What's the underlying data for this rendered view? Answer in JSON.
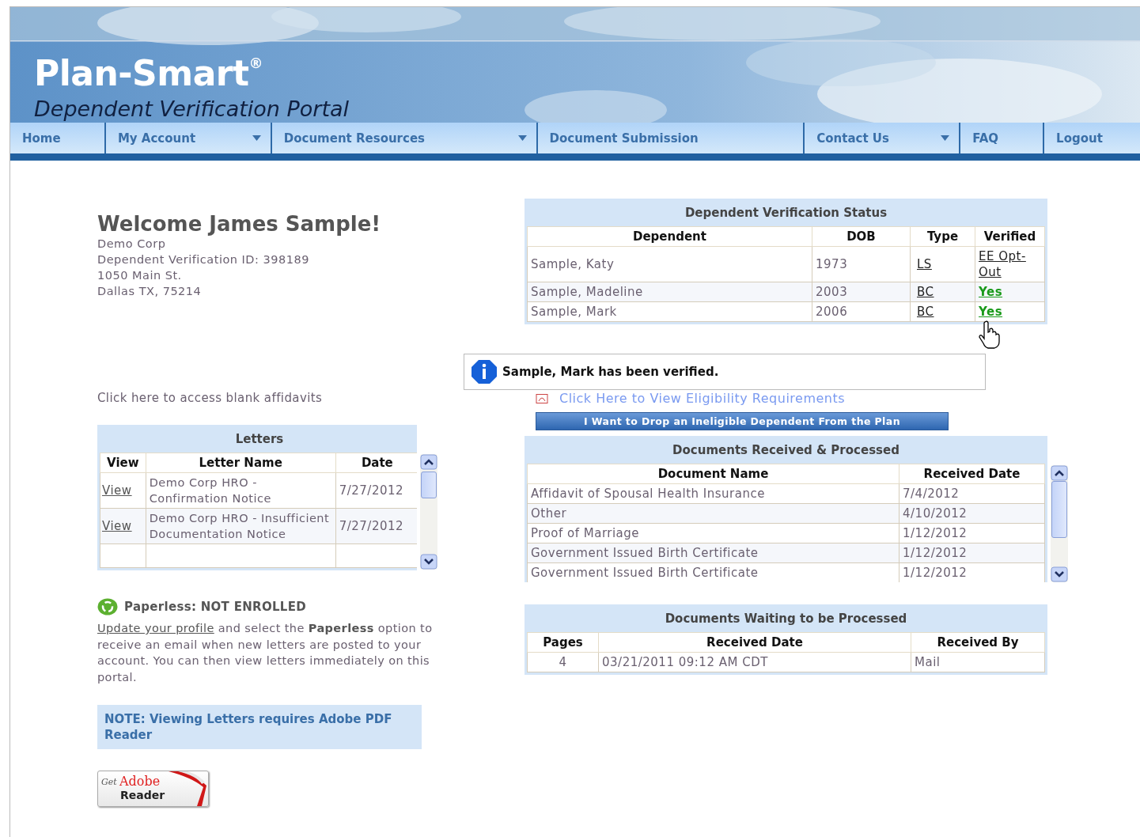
{
  "header": {
    "brand": "Plan-Smart",
    "brand_mark": "®",
    "subtitle": "Dependent Verification Portal"
  },
  "nav": [
    {
      "label": "Home",
      "dropdown": false
    },
    {
      "label": "My Account",
      "dropdown": true
    },
    {
      "label": "Document Resources",
      "dropdown": true
    },
    {
      "label": "Document Submission",
      "dropdown": false
    },
    {
      "label": "Contact Us",
      "dropdown": true
    },
    {
      "label": "FAQ",
      "dropdown": false
    },
    {
      "label": "Logout",
      "dropdown": false
    }
  ],
  "welcome": {
    "heading": "Welcome James Sample!",
    "lines": [
      "Demo Corp",
      "Dependent Verification ID: 398189",
      "1050 Main St.",
      "Dallas TX, 75214"
    ]
  },
  "affidavits_link": "Click here to access blank affidavits",
  "letters": {
    "title": "Letters",
    "columns": [
      "View",
      "Letter Name",
      "Date"
    ],
    "rows": [
      {
        "view": "View",
        "name": "Demo Corp HRO - Confirmation Notice",
        "date": "7/27/2012"
      },
      {
        "view": "View",
        "name": "Demo Corp HRO - Insufficient Documentation Notice",
        "date": "7/27/2012"
      }
    ]
  },
  "paperless": {
    "status": "Paperless: NOT ENROLLED",
    "link": "Update your profile",
    "text": " and select the **Paperless** option to receive an email when new letters are posted to your account. You can then view letters immediately on this portal."
  },
  "note": "NOTE: Viewing Letters requires Adobe PDF Reader",
  "adobe_badge": {
    "get": "Get",
    "brand": "Adobe",
    "product": "Reader"
  },
  "status_table": {
    "title": "Dependent Verification Status",
    "columns": [
      "Dependent",
      "DOB",
      "Type",
      "Verified"
    ],
    "rows": [
      {
        "dependent": "Sample, Katy",
        "dob": "1973",
        "type": "LS",
        "verified": "EE Opt-Out",
        "kind": "opt_out"
      },
      {
        "dependent": "Sample, Madeline",
        "dob": "2003",
        "type": "BC",
        "verified": "Yes",
        "kind": "yes"
      },
      {
        "dependent": "Sample, Mark",
        "dob": "2006",
        "type": "BC",
        "verified": "Yes",
        "kind": "yes"
      }
    ]
  },
  "toast": {
    "message": "Sample, Mark has been verified."
  },
  "eligibility_link": "Click Here to View Eligibility Requirements",
  "drop_button": "I Want to Drop an Ineligible Dependent From the Plan",
  "documents_received": {
    "title": "Documents Received & Processed",
    "columns": [
      "Document Name",
      "Received Date"
    ],
    "rows": [
      {
        "name": "Affidavit of Spousal Health Insurance",
        "date": "7/4/2012"
      },
      {
        "name": "Other",
        "date": "4/10/2012"
      },
      {
        "name": "Proof of Marriage",
        "date": "1/12/2012"
      },
      {
        "name": "Government Issued Birth Certificate",
        "date": "1/12/2012"
      },
      {
        "name": "Government Issued Birth Certificate",
        "date": "1/12/2012"
      }
    ]
  },
  "documents_waiting": {
    "title": "Documents Waiting to be Processed",
    "columns": [
      "Pages",
      "Received Date",
      "Received By"
    ],
    "rows": [
      {
        "pages": "4",
        "date": "03/21/2011 09:12 AM CDT",
        "by": "Mail"
      }
    ]
  }
}
